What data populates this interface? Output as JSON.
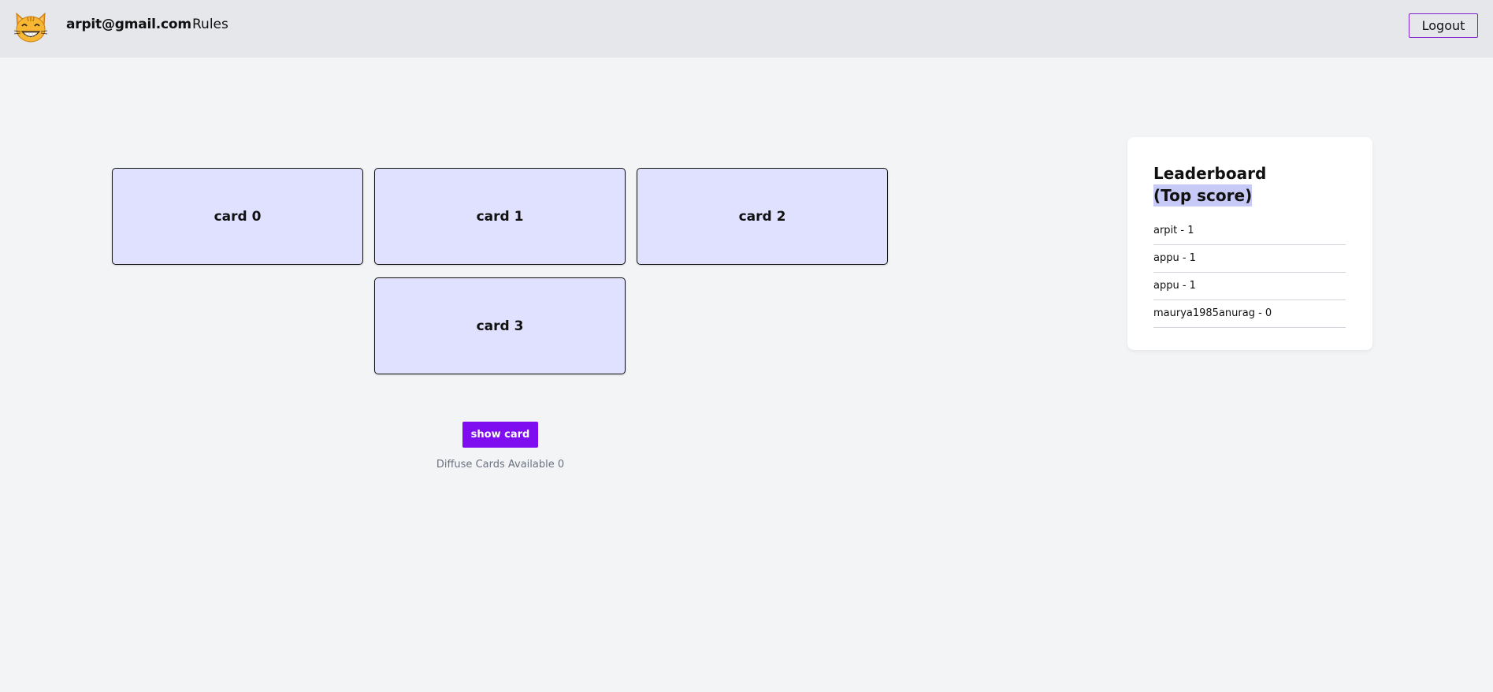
{
  "header": {
    "email": "arpit@gmail.com",
    "rules_label": "Rules",
    "logout_label": "Logout"
  },
  "game": {
    "cards": [
      {
        "label": "card 0"
      },
      {
        "label": "card 1"
      },
      {
        "label": "card 2"
      },
      {
        "label": "card 3"
      }
    ],
    "show_card_label": "show card",
    "diffuse_text": "Diffuse Cards Available 0"
  },
  "leaderboard": {
    "title": "Leaderboard",
    "subtitle": "(Top score)",
    "entries": [
      {
        "text": "arpit - 1"
      },
      {
        "text": "appu - 1"
      },
      {
        "text": "appu - 1"
      },
      {
        "text": "maurya1985anurag - 0"
      }
    ]
  },
  "colors": {
    "accent": "#7e0ef0",
    "card_bg": "#e0e0ff",
    "page_bg": "#f3f4f6",
    "nav_bg": "#e5e7eb"
  },
  "icons": {
    "logo": "grinning-cat-icon"
  }
}
